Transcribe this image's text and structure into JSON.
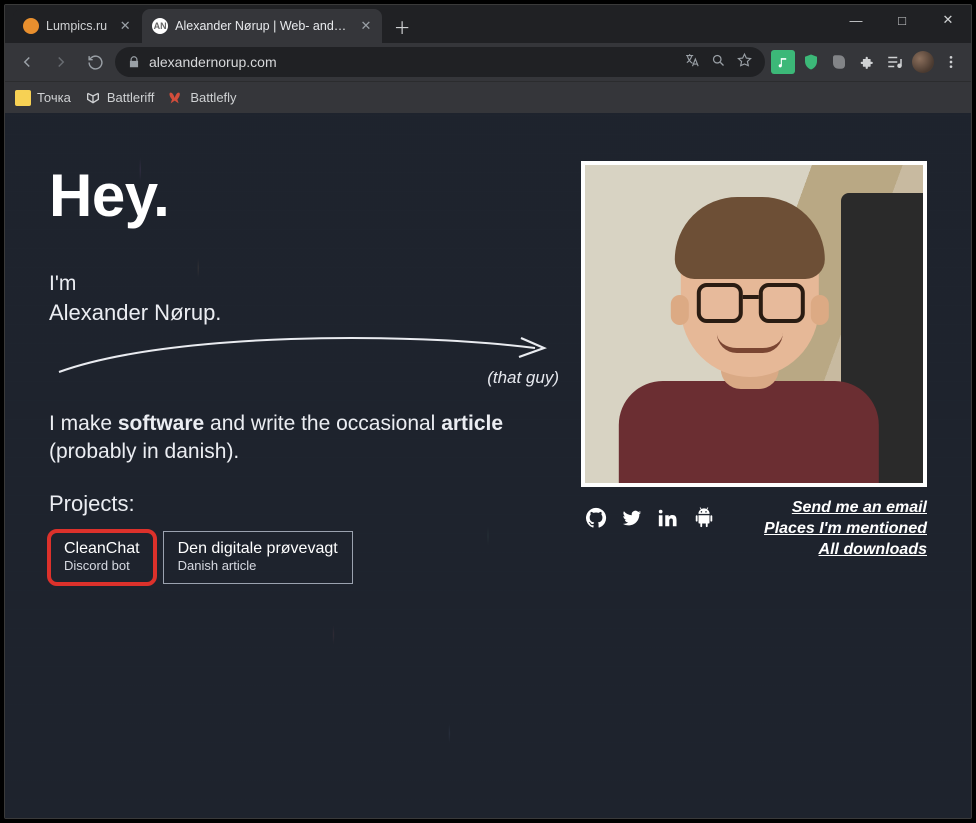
{
  "window": {
    "min": "—",
    "max": "□",
    "close": "✕"
  },
  "tabs": [
    {
      "title": "Lumpics.ru",
      "favicon": "orange",
      "active": false
    },
    {
      "title": "Alexander Nørup | Web- and soft…",
      "favicon": "AN",
      "active": true
    }
  ],
  "newtab": "＋",
  "nav": {
    "url": "alexandernorup.com"
  },
  "bookmarks": [
    {
      "label": "Точка",
      "color": "#f7d154"
    },
    {
      "label": "Battleriff",
      "color": ""
    },
    {
      "label": "Battlefly",
      "color": ""
    }
  ],
  "page": {
    "hey": "Hey.",
    "iam": "I'm",
    "name": "Alexander Nørup.",
    "thatguy": "(that guy)",
    "desc_pre": "I make ",
    "desc_b1": "software",
    "desc_mid": " and write the occasional ",
    "desc_b2": "article",
    "desc_post": " (probably in danish).",
    "projects_h": "Projects:",
    "projects": [
      {
        "title": "CleanChat",
        "sub": "Discord bot",
        "hl": true
      },
      {
        "title": "Den digitale prøvevagt",
        "sub": "Danish article",
        "hl": false
      }
    ],
    "links": [
      "Send me an email",
      "Places I'm mentioned",
      "All downloads"
    ]
  }
}
